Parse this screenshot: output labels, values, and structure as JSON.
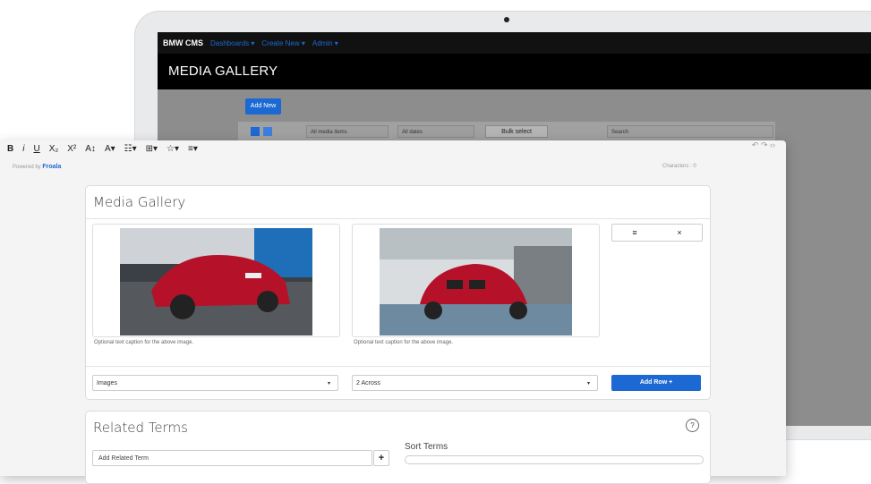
{
  "app": {
    "brand": "BMW CMS",
    "nav": [
      "Dashboards ▾",
      "Create New ▾",
      "Admin ▾"
    ],
    "page_title": "MEDIA GALLERY"
  },
  "gallery_admin": {
    "add_new": "Add New",
    "filter_media": "All media items",
    "filter_dates": "All dates",
    "bulk_select": "Bulk select",
    "search_placeholder": "Search"
  },
  "editor": {
    "toolbar": [
      "B",
      "i",
      "U",
      "X₂",
      "X²",
      "A↕",
      "A▾",
      "☷▾",
      "⊞▾",
      "☆▾",
      "≡▾"
    ],
    "toolbar_right": "↶  ↷  ‹›",
    "powered_by": "Powered by",
    "powered_brand": "Froala",
    "characters": "Characters : 0"
  },
  "media_gallery": {
    "title": "Media Gallery",
    "captions": [
      "Optional text caption for the above image.",
      "Optional text caption for the above image."
    ],
    "controls": [
      "≡",
      "×"
    ],
    "type_select": "Images",
    "layout_select": "2 Across",
    "add_row": "Add Row +"
  },
  "related_terms": {
    "title": "Related Terms",
    "help_icon": "?",
    "add_placeholder": "Add Related Term",
    "add_button": "+",
    "sort_label": "Sort Terms"
  },
  "colors": {
    "accent": "#1c69d4",
    "topbar": "#111111",
    "car_red": "#b5122a"
  }
}
